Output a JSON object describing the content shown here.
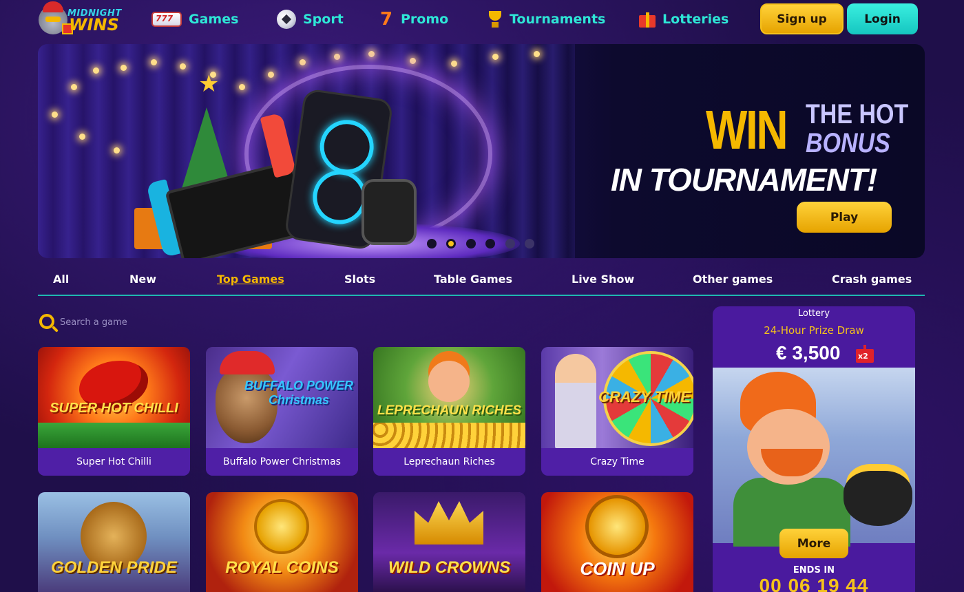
{
  "brand": {
    "logo_top": "MIDNIGHT",
    "logo_bottom": "WINS"
  },
  "nav": [
    {
      "label": "Games",
      "icon": "slot-machine-icon"
    },
    {
      "label": "Sport",
      "icon": "soccer-ball-icon"
    },
    {
      "label": "Promo",
      "icon": "lucky-seven-icon"
    },
    {
      "label": "Tournaments",
      "icon": "trophy-icon"
    },
    {
      "label": "Lotteries",
      "icon": "gift-icon"
    }
  ],
  "auth": {
    "signup": "Sign up",
    "login": "Login"
  },
  "banner": {
    "win": "WIN",
    "the_hot": "THE HOT",
    "bonus": "BONUS",
    "tournament": "IN TOURNAMENT!",
    "cta": "Play",
    "slides": 6,
    "active_slide": 2
  },
  "categories": [
    "All",
    "New",
    "Top Games",
    "Slots",
    "Table Games",
    "Live Show",
    "Other games",
    "Crash games"
  ],
  "active_category": "Top Games",
  "search": {
    "placeholder": "Search a game",
    "value": ""
  },
  "games": [
    {
      "title": "Super Hot Chilli",
      "art_text": "SUPER HOT CHILLI"
    },
    {
      "title": "Buffalo Power Christmas",
      "art_text": "BUFFALO POWER Christmas"
    },
    {
      "title": "Leprechaun Riches",
      "art_text": "LEPRECHAUN RICHES"
    },
    {
      "title": "Crazy Time",
      "art_text": "CRAZY TIME"
    },
    {
      "title": "",
      "art_text": "GOLDEN PRIDE"
    },
    {
      "title": "",
      "art_text": "ROYAL COINS"
    },
    {
      "title": "",
      "art_text": "WILD CROWNS"
    },
    {
      "title": "",
      "art_text": "COIN UP"
    }
  ],
  "lottery": {
    "label": "Lottery",
    "draw": "24-Hour Prize Draw",
    "amount": "€ 3,500",
    "multiplier": "x2",
    "cta": "More",
    "ends_label": "ENDS IN",
    "timer": "00 06 19 44"
  }
}
